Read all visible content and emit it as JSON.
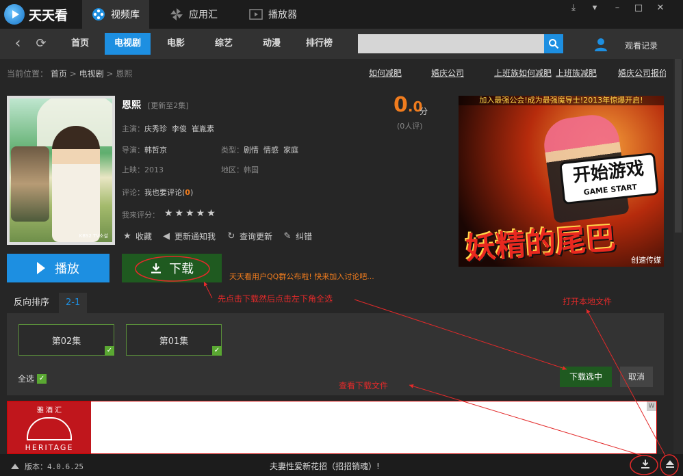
{
  "app": {
    "name": "天天看",
    "main_tabs": [
      {
        "label": "视频库",
        "icon": "reel-icon",
        "active": true
      },
      {
        "label": "应用汇",
        "icon": "pinwheel-icon",
        "active": false
      },
      {
        "label": "播放器",
        "icon": "player-icon",
        "active": false
      }
    ],
    "window_controls": [
      "skin-icon",
      "menu-icon",
      "minimize-icon",
      "maximize-icon",
      "close-icon"
    ]
  },
  "nav": {
    "items": [
      "首页",
      "电视剧",
      "电影",
      "综艺",
      "动漫",
      "排行榜"
    ],
    "active": "电视剧",
    "search_placeholder": "",
    "history_label": "观看记录"
  },
  "breadcrumb": {
    "prefix": "当前位置：",
    "home": "首页",
    "sep": ">",
    "category": "电视剧",
    "current": "恩熙"
  },
  "hot_topics": [
    "如何减肥",
    "婚庆公司",
    "上班族如何减肥",
    "上班族减肥",
    "婚庆公司报价"
  ],
  "show": {
    "title": "恩熙",
    "update_note": "[更新至2集]",
    "poster_tag": "KBS2 TV소설",
    "cast_label": "主演：",
    "cast": [
      "庆秀珍",
      "李俊",
      "崔胤素"
    ],
    "director_label": "导演：",
    "director": "韩哲京",
    "type_label": "类型：",
    "types": [
      "剧情",
      "情感",
      "家庭"
    ],
    "release_label": "上映：",
    "release": "2013",
    "region_label": "地区：",
    "region": "韩国",
    "comment_label": "评论：",
    "comment_link": "我也要评论(",
    "comment_count": "0",
    "comment_close": ")",
    "rate_label": "我来评分：",
    "stars": "★★★★★",
    "score_int": "0",
    "score_dec": ".0",
    "score_unit": "分",
    "score_count": "(0人评)",
    "actions": [
      {
        "label": "收藏",
        "icon": "star-icon"
      },
      {
        "label": "更新通知我",
        "icon": "speaker-icon"
      },
      {
        "label": "查询更新",
        "icon": "refresh-icon"
      },
      {
        "label": "纠错",
        "icon": "pencil-icon"
      }
    ]
  },
  "buttons": {
    "play": "播放",
    "download": "下载",
    "qq_note": "天天看用户QQ群公布啦! 快来加入讨论吧..."
  },
  "ad": {
    "banner": "加入最强公会!成为最强魔导士!2013年惊爆开启!",
    "start_cn": "开始游戏",
    "start_en": "GAME START",
    "title": "妖精的尾巴",
    "brand": "创速传媒"
  },
  "episodes": {
    "order_label": "反向排序",
    "range_label": "2-1",
    "items": [
      {
        "label": "第02集",
        "checked": true
      },
      {
        "label": "第01集",
        "checked": true
      }
    ],
    "select_all": "全选",
    "download_selected": "下载选中",
    "cancel": "取消"
  },
  "bottom_ad": {
    "cn": "雅 酒 汇",
    "en": "HERITAGE",
    "badge": "W"
  },
  "status": {
    "version": "版本：4.0.6.25",
    "marquee": "夫妻性爱新花招（招招销魂）!"
  },
  "annotations": {
    "step1": "先点击下载然后点击左下角全选",
    "open_local": "打开本地文件",
    "view_downloads": "查看下载文件"
  }
}
